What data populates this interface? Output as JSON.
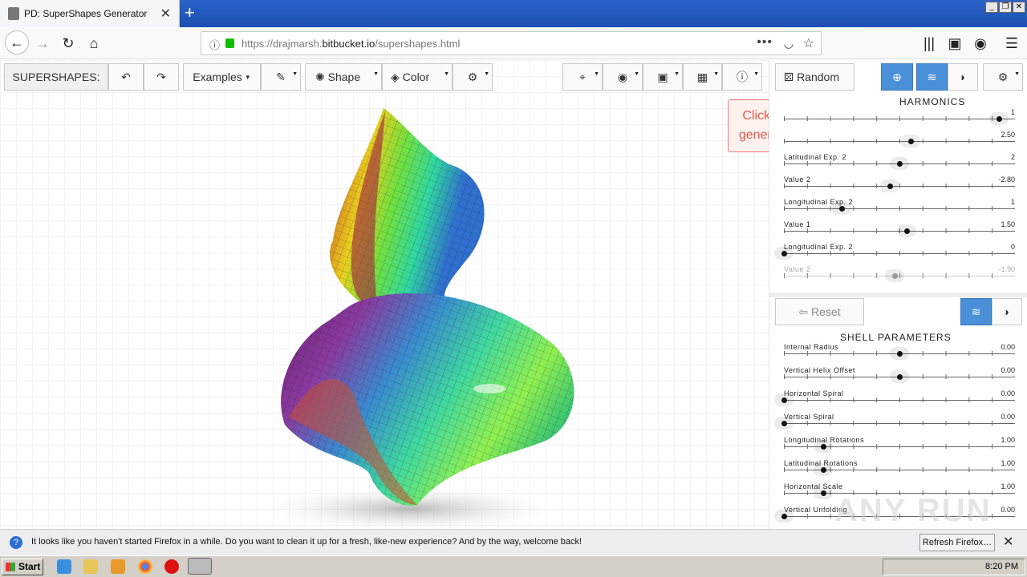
{
  "browser": {
    "tab_title": "PD: SuperShapes Generator",
    "url_prefix": "https://drajmarsh.",
    "url_domain": "bitbucket.io",
    "url_path": "/supershapes.html"
  },
  "toolbar": {
    "app_label": "SUPERSHAPES:",
    "examples": "Examples",
    "shape": "Shape",
    "color": "Color",
    "random": "Random"
  },
  "tooltip": "Click here or press 'R' to generate random shapes.",
  "harmonics": {
    "title": "HARMONICS",
    "rows": [
      {
        "label": "",
        "value": "1",
        "pos": 0.93
      },
      {
        "label": "",
        "value": "2.50",
        "pos": 0.55
      },
      {
        "label": "Latitudinal Exp. 2",
        "value": "2",
        "pos": 0.5
      },
      {
        "label": "Value 2",
        "value": "-2.80",
        "pos": 0.46
      },
      {
        "label": "Longitudinal Exp. 2",
        "value": "1",
        "pos": 0.25
      },
      {
        "label": "Value 1",
        "value": "1.50",
        "pos": 0.53
      },
      {
        "label": "Longitudinal Exp. 2",
        "value": "0",
        "pos": 0.0
      },
      {
        "label": "Value 2",
        "value": "-1.90",
        "pos": 0.48
      }
    ]
  },
  "reset": "Reset",
  "shell": {
    "title": "SHELL PARAMETERS",
    "rows": [
      {
        "label": "Internal Radius",
        "value": "0.00",
        "pos": 0.5
      },
      {
        "label": "Vertical Helix Offset",
        "value": "0.00",
        "pos": 0.5
      },
      {
        "label": "Horizontal Spiral",
        "value": "0.00",
        "pos": 0.0
      },
      {
        "label": "Vertical Spiral",
        "value": "0.00",
        "pos": 0.0
      },
      {
        "label": "Longitudinal Rotations",
        "value": "1.00",
        "pos": 0.17
      },
      {
        "label": "Latitudinal Rotations",
        "value": "1.00",
        "pos": 0.17
      },
      {
        "label": "Horizontal Scale",
        "value": "1.00",
        "pos": 0.17
      },
      {
        "label": "Vertical Unfolding",
        "value": "0.00",
        "pos": 0.0
      }
    ]
  },
  "notification": {
    "message": "It looks like you haven't started Firefox in a while. Do you want to clean it up for a fresh, like-new experience? And by the way, welcome back!",
    "button": "Refresh Firefox…"
  },
  "taskbar": {
    "start": "Start",
    "time": "8:20 PM"
  },
  "watermark": "ANY RUN"
}
